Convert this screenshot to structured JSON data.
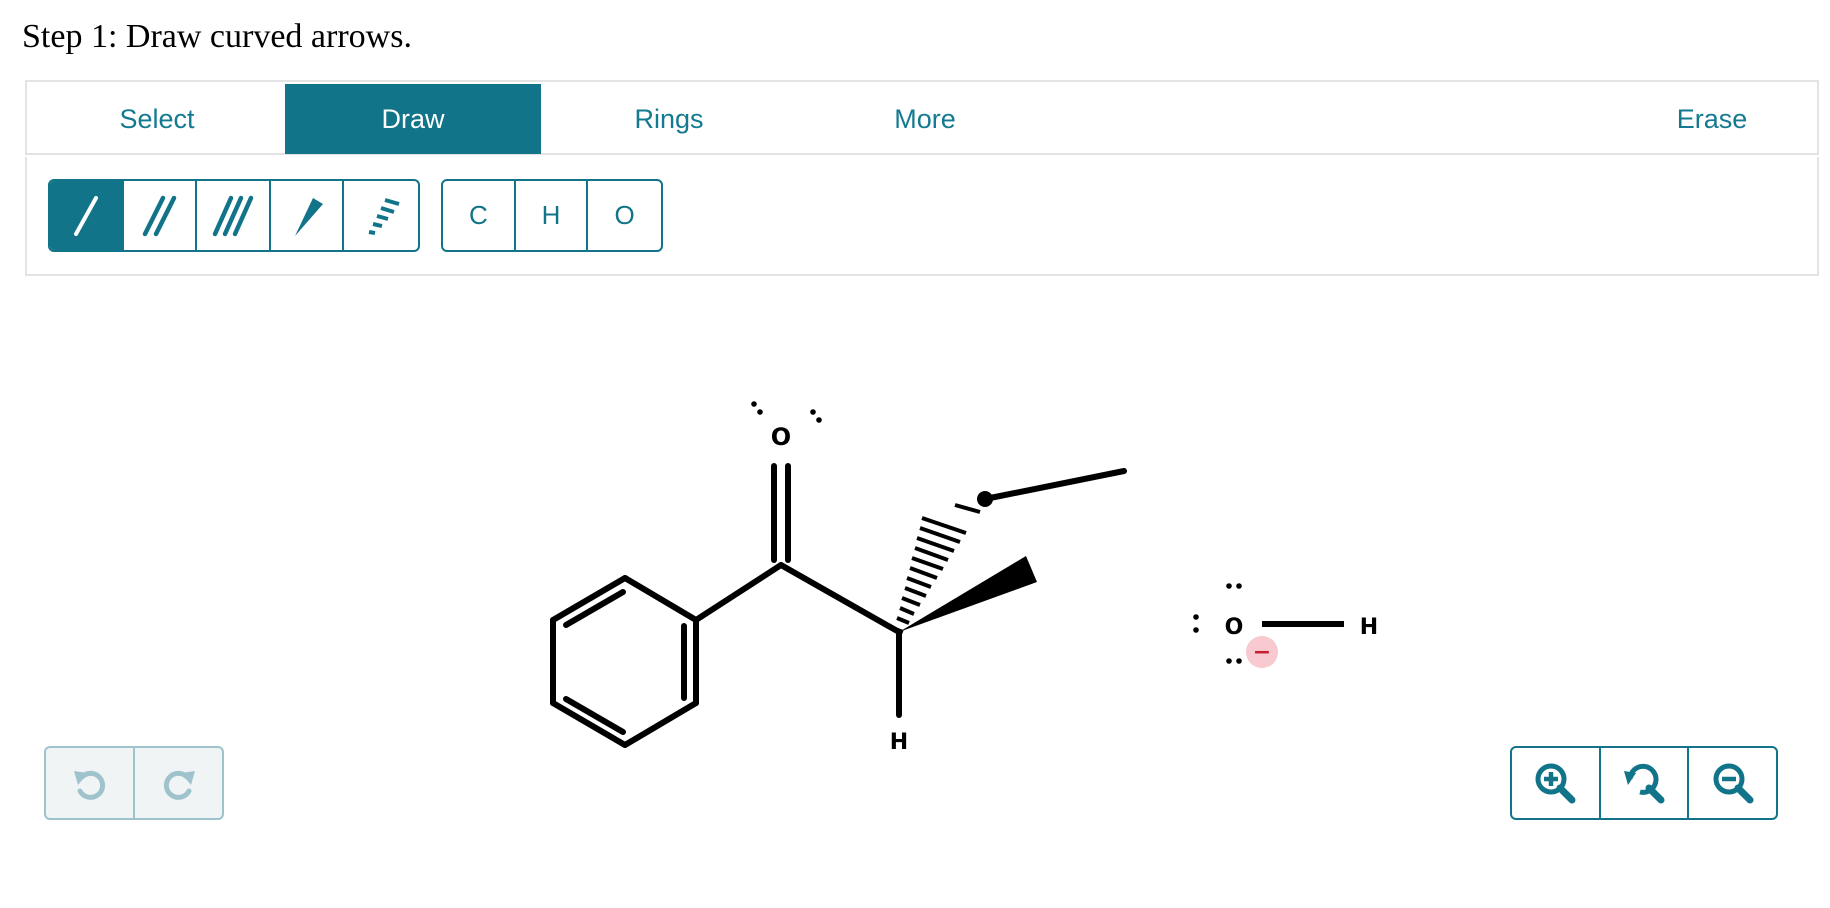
{
  "step": {
    "title": "Step 1: Draw curved arrows."
  },
  "tabs": [
    {
      "label": "Select",
      "active": false
    },
    {
      "label": "Draw",
      "active": true
    },
    {
      "label": "Rings",
      "active": false
    },
    {
      "label": "More",
      "active": false
    },
    {
      "label": "Erase",
      "active": false
    }
  ],
  "bond_tools": [
    {
      "icon": "single-bond-icon",
      "active": true
    },
    {
      "icon": "double-bond-icon",
      "active": false
    },
    {
      "icon": "triple-bond-icon",
      "active": false
    },
    {
      "icon": "wedge-bond-icon",
      "active": false
    },
    {
      "icon": "hash-bond-icon",
      "active": false
    }
  ],
  "atoms": [
    "C",
    "H",
    "O"
  ],
  "molecule": {
    "carbonyl_oxygen": "O",
    "alpha_hydrogen": "H",
    "hydroxide_oxygen": "O",
    "hydroxide_hydrogen": "H",
    "charge": "−"
  },
  "history": {
    "undo_icon": "undo-icon",
    "redo_icon": "redo-icon",
    "enabled": false
  },
  "zoom": {
    "in_icon": "zoom-in-icon",
    "reset_icon": "zoom-reset-icon",
    "out_icon": "zoom-out-icon"
  },
  "colors": {
    "accent": "#117489",
    "tab_text": "#147a91",
    "disabled": "#9fc3cc",
    "charge_bg": "#f8c9cf"
  }
}
